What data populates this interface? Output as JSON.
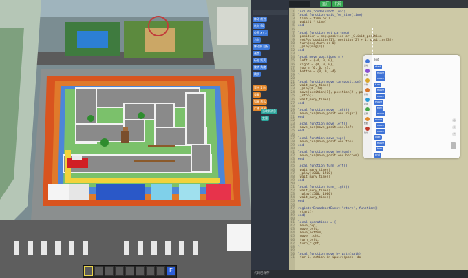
{
  "editor": {
    "tabs": [
      "代码",
      "",
      "",
      "运行",
      "代码"
    ],
    "run_label": "运行",
    "code_label": "代码",
    "status": "代码已保存",
    "lines": [
      {
        "n": "1",
        "t": "include(\"code/robot.lua\")"
      },
      {
        "n": "2",
        "t": "local function wait_for_time(time)"
      },
      {
        "n": "3",
        "t": "  time = time or 1"
      },
      {
        "n": "4",
        "t": "  wait(1 * time)"
      },
      {
        "n": "5",
        "t": "end"
      },
      {
        "n": "6",
        "t": ""
      },
      {
        "n": "7",
        "t": "local function set_car(msg)"
      },
      {
        "n": "8",
        "t": "  position = msg.position or _G.init_position"
      },
      {
        "n": "9",
        "t": "  setPos(position[1], position[2] + 1, position[3])"
      },
      {
        "n": "10",
        "t": "  turn(msg.turn or 0)"
      },
      {
        "n": "11",
        "t": "  _play(msg[1])"
      },
      {
        "n": "12",
        "t": "end"
      },
      {
        "n": "13",
        "t": ""
      },
      {
        "n": "14",
        "t": "local move_positions = {"
      },
      {
        "n": "15",
        "t": "  left = {-4, 0, 0},"
      },
      {
        "n": "16",
        "t": "  right = {4, 0, 0},"
      },
      {
        "n": "17",
        "t": "  top = {0, 0, 4},"
      },
      {
        "n": "18",
        "t": "  bottom = {0, 0, -4},"
      },
      {
        "n": "19",
        "t": "}"
      },
      {
        "n": "20",
        "t": ""
      },
      {
        "n": "21",
        "t": "local function move_car(position)"
      },
      {
        "n": "22",
        "t": "  wait_many_time()"
      },
      {
        "n": "23",
        "t": "  _play(0, 20)"
      },
      {
        "n": "24",
        "t": "  move(position[1], position[2], position[3], 0.5)"
      },
      {
        "n": "25",
        "t": "  _stop()"
      },
      {
        "n": "26",
        "t": "  wait_many_time()"
      },
      {
        "n": "27",
        "t": "end"
      },
      {
        "n": "28",
        "t": ""
      },
      {
        "n": "29",
        "t": "local function move_right()"
      },
      {
        "n": "30",
        "t": "  move_car(move_positions.right)"
      },
      {
        "n": "31",
        "t": "end"
      },
      {
        "n": "32",
        "t": ""
      },
      {
        "n": "33",
        "t": "local function move_left()"
      },
      {
        "n": "34",
        "t": "  move_car(move_positions.left)"
      },
      {
        "n": "35",
        "t": "end"
      },
      {
        "n": "36",
        "t": ""
      },
      {
        "n": "37",
        "t": "local function move_top()"
      },
      {
        "n": "38",
        "t": "  move_car(move_positions.top)"
      },
      {
        "n": "39",
        "t": "end"
      },
      {
        "n": "40",
        "t": ""
      },
      {
        "n": "41",
        "t": "local function move_bottom()"
      },
      {
        "n": "42",
        "t": "  move_car(move_positions.bottom)"
      },
      {
        "n": "43",
        "t": "end"
      },
      {
        "n": "44",
        "t": ""
      },
      {
        "n": "45",
        "t": "local function turn_left()"
      },
      {
        "n": "46",
        "t": "  wait_many_time()"
      },
      {
        "n": "47",
        "t": "  _play(1000, 1500)"
      },
      {
        "n": "48",
        "t": "  wait_many_time()"
      },
      {
        "n": "49",
        "t": "end"
      },
      {
        "n": "50",
        "t": ""
      },
      {
        "n": "51",
        "t": "local function turn_right()"
      },
      {
        "n": "52",
        "t": "  wait_many_time()"
      },
      {
        "n": "53",
        "t": "  _play(1500, 1000)"
      },
      {
        "n": "54",
        "t": "  wait_many_time()"
      },
      {
        "n": "55",
        "t": "end"
      },
      {
        "n": "56",
        "t": ""
      },
      {
        "n": "57",
        "t": "registerBroadcastEvent(\"start\", function()"
      },
      {
        "n": "58",
        "t": "  start()"
      },
      {
        "n": "59",
        "t": "end)"
      },
      {
        "n": "60",
        "t": ""
      },
      {
        "n": "61",
        "t": "local operations = {"
      },
      {
        "n": "62",
        "t": "  move_top,"
      },
      {
        "n": "63",
        "t": "  move_left,"
      },
      {
        "n": "64",
        "t": "  move_bottom,"
      },
      {
        "n": "65",
        "t": "  move_right,"
      },
      {
        "n": "66",
        "t": "  turn_left,"
      },
      {
        "n": "67",
        "t": "  turn_right,"
      },
      {
        "n": "68",
        "t": "}"
      },
      {
        "n": "69",
        "t": ""
      },
      {
        "n": "70",
        "t": "local function move_by_path(path)"
      },
      {
        "n": "71",
        "t": "  for i, action in ipairs(path) do"
      }
    ]
  },
  "block_palette": {
    "items": [
      {
        "label": "移动 前进",
        "color": "blue"
      },
      {
        "label": "转向 90",
        "color": "blue"
      },
      {
        "label": "位置 x y z",
        "color": "blue"
      },
      {
        "label": "方向",
        "color": "blue"
      },
      {
        "label": "移动到 目标",
        "color": "blue"
      },
      {
        "label": "速度",
        "color": "blue"
      },
      {
        "label": "行走 距离",
        "color": "blue"
      },
      {
        "label": "旋转 角度",
        "color": "blue"
      },
      {
        "label": "跳跃",
        "color": "blue"
      },
      {
        "label": "等待 1 秒",
        "color": "orange"
      },
      {
        "label": "重复",
        "color": "orange"
      },
      {
        "label": "如果 那么",
        "color": "orange"
      },
      {
        "label": "广播 消息",
        "color": "orange"
      },
      {
        "label": "当收到消息",
        "color": "teal"
      },
      {
        "label": "变量",
        "color": "teal"
      }
    ]
  },
  "blockly": {
    "end_label": "end",
    "toolbox": [
      {
        "label": "运动",
        "color": "#3f73d6"
      },
      {
        "label": "外观",
        "color": "#8a4fd1"
      },
      {
        "label": "事件",
        "color": "#d9a62a"
      },
      {
        "label": "控制",
        "color": "#d6762a"
      },
      {
        "label": "感知",
        "color": "#2a9bd6"
      },
      {
        "label": "运算",
        "color": "#46a747"
      },
      {
        "label": "数据",
        "color": "#e0892a"
      },
      {
        "label": "我的",
        "color": "#c0392b"
      }
    ],
    "blocks": [
      {
        "label": "start"
      },
      {
        "label": "move"
      },
      {
        "label": "move"
      },
      {
        "label": "turn"
      },
      {
        "label": "move"
      },
      {
        "label": "move"
      },
      {
        "label": "move"
      },
      {
        "label": "turn"
      },
      {
        "label": "move"
      },
      {
        "label": "move"
      },
      {
        "label": "move"
      },
      {
        "label": "move"
      },
      {
        "label": "wait"
      },
      {
        "label": "move"
      },
      {
        "label": "turn"
      },
      {
        "label": "end"
      }
    ]
  },
  "hotbar": {
    "selected_label": "E"
  }
}
